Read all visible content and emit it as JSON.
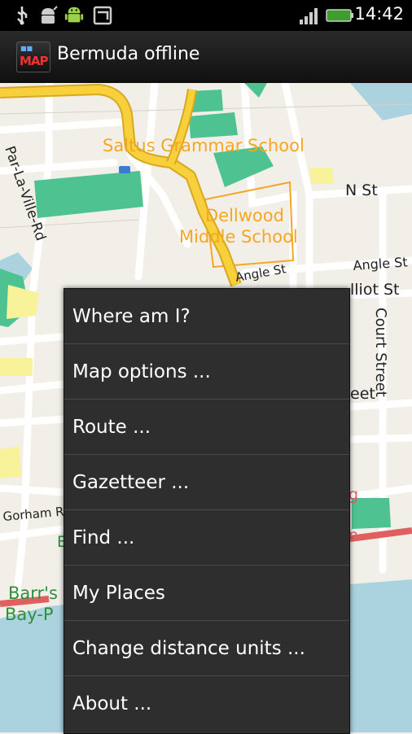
{
  "status_bar": {
    "time": "14:42",
    "left_icons": [
      "usb-icon",
      "android-debug-icon",
      "android-icon",
      "sync-icon"
    ],
    "right_icons": [
      "signal-icon",
      "battery-icon"
    ]
  },
  "app": {
    "title": "Bermuda offline",
    "icon_text": "MAP"
  },
  "map": {
    "labels": {
      "saltus": "Saltus Grammar School",
      "dellwood_1": "Dellwood",
      "dellwood_2": "Middle School",
      "n_st": "N St",
      "par_la_ville": "Par-La-Ville-Rd",
      "angle_st_1": "Angle St",
      "angle_st_2": "Angle St",
      "elliot_st": "lliot St",
      "court_street": "Court Street",
      "eet": "eet",
      "gorham": "Gorham R",
      "barrs_1": "Barr's",
      "barrs_2": "Bay-P",
      "green_e": "E",
      "red_g": "g",
      "red_n": "n"
    }
  },
  "menu": {
    "items": [
      {
        "label": "Where am I?"
      },
      {
        "label": "Map options ..."
      },
      {
        "label": "Route ..."
      },
      {
        "label": "Gazetteer ..."
      },
      {
        "label": "Find ..."
      },
      {
        "label": "My Places"
      },
      {
        "label": "Change distance units ..."
      },
      {
        "label": "About ..."
      }
    ]
  },
  "colors": {
    "water": "#aad3df",
    "building": "#4fc292",
    "road_major": "#f7d03c",
    "school_outline": "#f5a623",
    "label_orange": "#f5a623",
    "park_green": "#2f8f3a",
    "red_road": "#e06060"
  }
}
